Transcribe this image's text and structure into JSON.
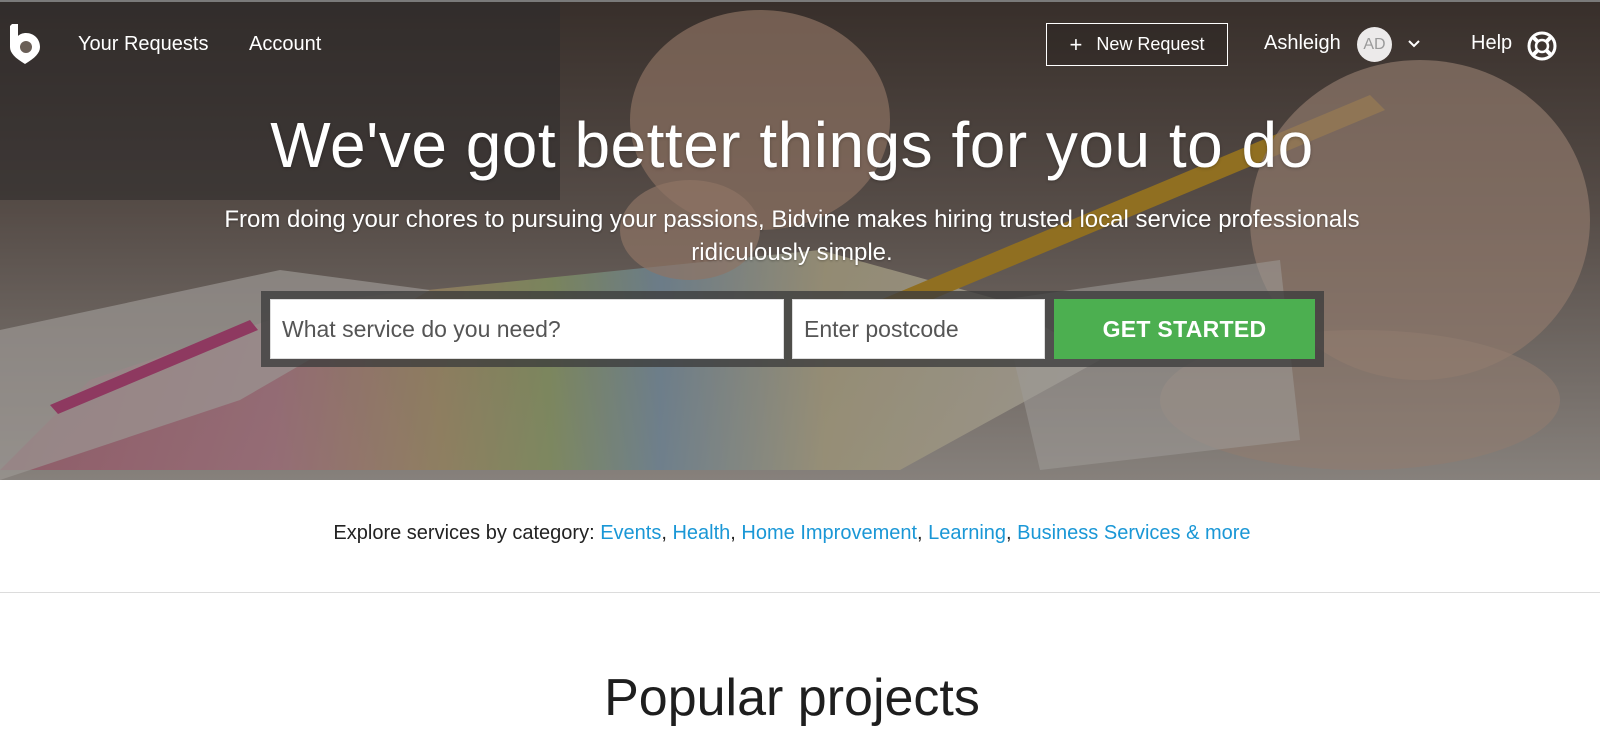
{
  "nav": {
    "your_requests": "Your Requests",
    "account": "Account",
    "new_request": "New Request",
    "user_name": "Ashleigh",
    "avatar_initials": "AD",
    "help": "Help"
  },
  "hero": {
    "headline": "We've got better things for you to do",
    "subheadline": "From doing your chores to pursuing your passions, Bidvine makes hiring trusted local service professionals ridiculously simple."
  },
  "search": {
    "service_placeholder": "What service do you need?",
    "postcode_placeholder": "Enter postcode",
    "submit_label": "GET STARTED"
  },
  "categories": {
    "prefix": "Explore services by category: ",
    "items": [
      "Events",
      "Health",
      "Home Improvement",
      "Learning",
      "Business Services & more"
    ]
  },
  "popular": {
    "title": "Popular projects"
  },
  "colors": {
    "accent_green": "#4caf50",
    "link_blue": "#1a97d6"
  },
  "icons": {
    "logo": "bidvine-logo-icon",
    "plus": "plus-icon",
    "chevron": "chevron-down-icon",
    "help": "lifebuoy-icon"
  }
}
